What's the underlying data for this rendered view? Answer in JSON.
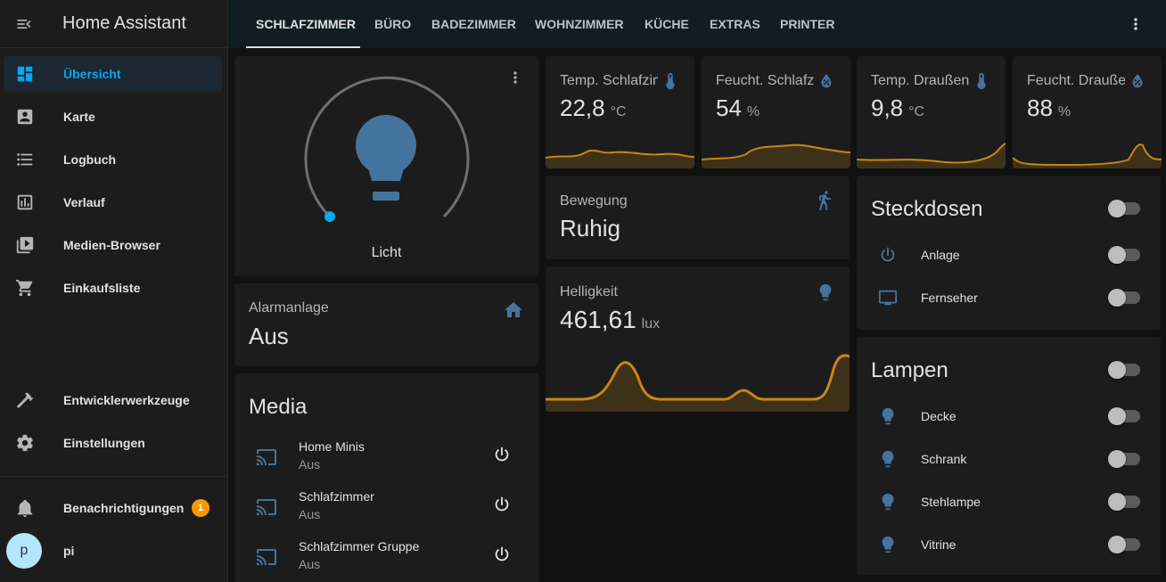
{
  "app_title": "Home Assistant",
  "sidebar": {
    "items": [
      {
        "label": "Übersicht",
        "icon": "dashboard-icon",
        "active": true
      },
      {
        "label": "Karte",
        "icon": "map-account-icon"
      },
      {
        "label": "Logbuch",
        "icon": "format-list-bulleted-icon"
      },
      {
        "label": "Verlauf",
        "icon": "chart-box-icon"
      },
      {
        "label": "Medien-Browser",
        "icon": "play-box-multiple-icon"
      },
      {
        "label": "Einkaufsliste",
        "icon": "cart-icon"
      }
    ],
    "dev_tools": "Entwicklerwerkzeuge",
    "settings": "Einstellungen",
    "notifications": "Benachrichtigungen",
    "notification_count": "1",
    "user_initial": "p",
    "user_name": "pi"
  },
  "tabs": [
    "SCHLAFZIMMER",
    "BÜRO",
    "BADEZIMMER",
    "WOHNZIMMER",
    "KÜCHE",
    "EXTRAS",
    "PRINTER"
  ],
  "light": {
    "name": "Licht",
    "brightness_fraction": 0.0
  },
  "alarm": {
    "label": "Alarmanlage",
    "state": "Aus"
  },
  "media": {
    "title": "Media",
    "players": [
      {
        "name": "Home Minis",
        "state": "Aus"
      },
      {
        "name": "Schlafzimmer",
        "state": "Aus"
      },
      {
        "name": "Schlafzimmer Gruppe",
        "state": "Aus"
      }
    ]
  },
  "sensors": [
    {
      "label": "Temp. Schlafzimmer",
      "value": "22,8",
      "unit": "°C",
      "icon": "thermometer-icon"
    },
    {
      "label": "Feucht. Schlafzimmer",
      "value": "54",
      "unit": "%",
      "icon": "water-percent-icon"
    },
    {
      "label": "Temp. Draußen",
      "value": "9,8",
      "unit": "°C",
      "icon": "thermometer-icon"
    },
    {
      "label": "Feucht. Draußen",
      "value": "88",
      "unit": "%",
      "icon": "water-percent-icon"
    }
  ],
  "motion": {
    "label": "Bewegung",
    "state": "Ruhig"
  },
  "brightness": {
    "label": "Helligkeit",
    "value": "461,61",
    "unit": "lux"
  },
  "sockets": {
    "title": "Steckdosen",
    "items": [
      {
        "name": "Anlage",
        "icon": "power-icon"
      },
      {
        "name": "Fernseher",
        "icon": "television-icon"
      }
    ]
  },
  "lamps": {
    "title": "Lampen",
    "items": [
      {
        "name": "Decke"
      },
      {
        "name": "Schrank"
      },
      {
        "name": "Stehlampe"
      },
      {
        "name": "Vitrine"
      }
    ]
  },
  "colors": {
    "accent": "#03a9f4",
    "icon_blue": "#44739e",
    "graph": "#c98511",
    "badge": "#ff9800"
  }
}
